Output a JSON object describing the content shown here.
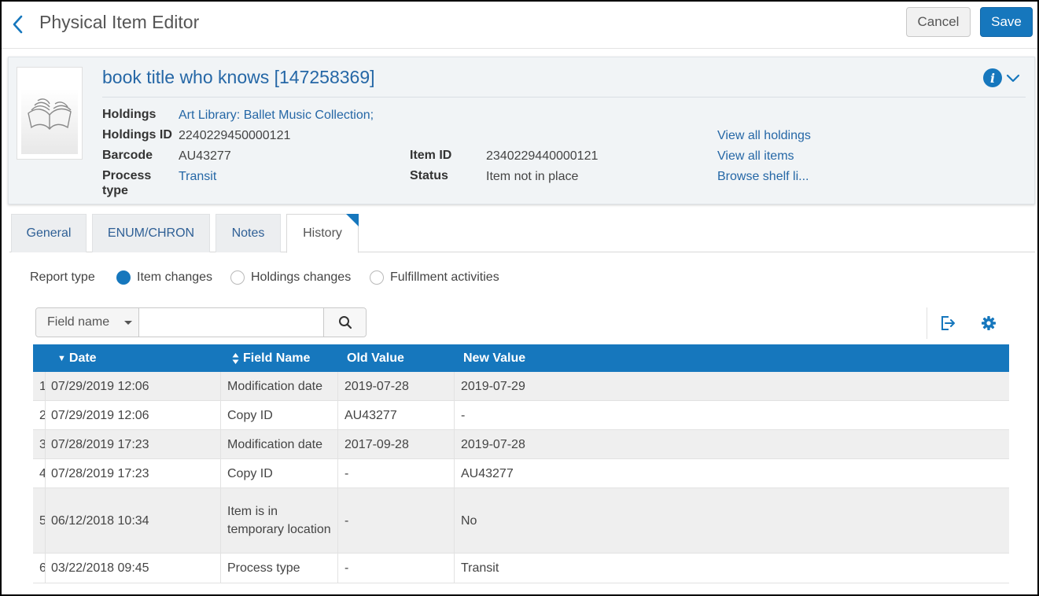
{
  "header": {
    "title": "Physical Item Editor",
    "cancel_label": "Cancel",
    "save_label": "Save"
  },
  "record": {
    "title": "book title who knows [147258369]",
    "fields": {
      "holdings_label": "Holdings",
      "holdings_value": "Art Library: Ballet Music Collection;",
      "holdings_id_label": "Holdings ID",
      "holdings_id_value": "2240229450000121",
      "barcode_label": "Barcode",
      "barcode_value": "AU43277",
      "process_type_label_1": "Process",
      "process_type_label_2": "type",
      "process_type_value": "Transit",
      "item_id_label": "Item ID",
      "item_id_value": "2340229440000121",
      "status_label": "Status",
      "status_value": "Item not in place"
    },
    "links": {
      "view_all_holdings": "View all holdings",
      "view_all_items": "View all items",
      "browse_shelf": "Browse shelf li..."
    }
  },
  "tabs": [
    {
      "label": "General"
    },
    {
      "label": "ENUM/CHRON"
    },
    {
      "label": "Notes"
    },
    {
      "label": "History",
      "active": true
    }
  ],
  "report": {
    "label": "Report type",
    "options": [
      {
        "label": "Item changes",
        "selected": true
      },
      {
        "label": "Holdings changes",
        "selected": false
      },
      {
        "label": "Fulfillment activities",
        "selected": false
      }
    ]
  },
  "search": {
    "field_select": "Field name",
    "value": ""
  },
  "table": {
    "columns": {
      "date": "Date",
      "field_name": "Field Name",
      "old_value": "Old Value",
      "new_value": "New Value"
    },
    "sort_indicator": "▼",
    "rows": [
      {
        "num": "1",
        "date": "07/29/2019 12:06",
        "field": "Modification date",
        "old": "2019-07-28",
        "new": "2019-07-29"
      },
      {
        "num": "2",
        "date": "07/29/2019 12:06",
        "field": "Copy ID",
        "old": "AU43277",
        "new": "-"
      },
      {
        "num": "3",
        "date": "07/28/2019 17:23",
        "field": "Modification date",
        "old": "2017-09-28",
        "new": "2019-07-28"
      },
      {
        "num": "4",
        "date": "07/28/2019 17:23",
        "field": "Copy ID",
        "old": "-",
        "new": "AU43277"
      },
      {
        "num": "5",
        "date": "06/12/2018 10:34",
        "field": "Item is in temporary location",
        "old": "-",
        "new": "No"
      },
      {
        "num": "6",
        "date": "03/22/2018 09:45",
        "field": "Process type",
        "old": "-",
        "new": "Transit"
      }
    ]
  },
  "colors": {
    "accent": "#1677bd",
    "link": "#2567a6"
  },
  "icons": {
    "back": "chevron-left-icon",
    "info": "info-icon",
    "expand": "chevron-down-icon",
    "search": "search-icon",
    "export": "export-icon",
    "settings": "gear-icon"
  }
}
